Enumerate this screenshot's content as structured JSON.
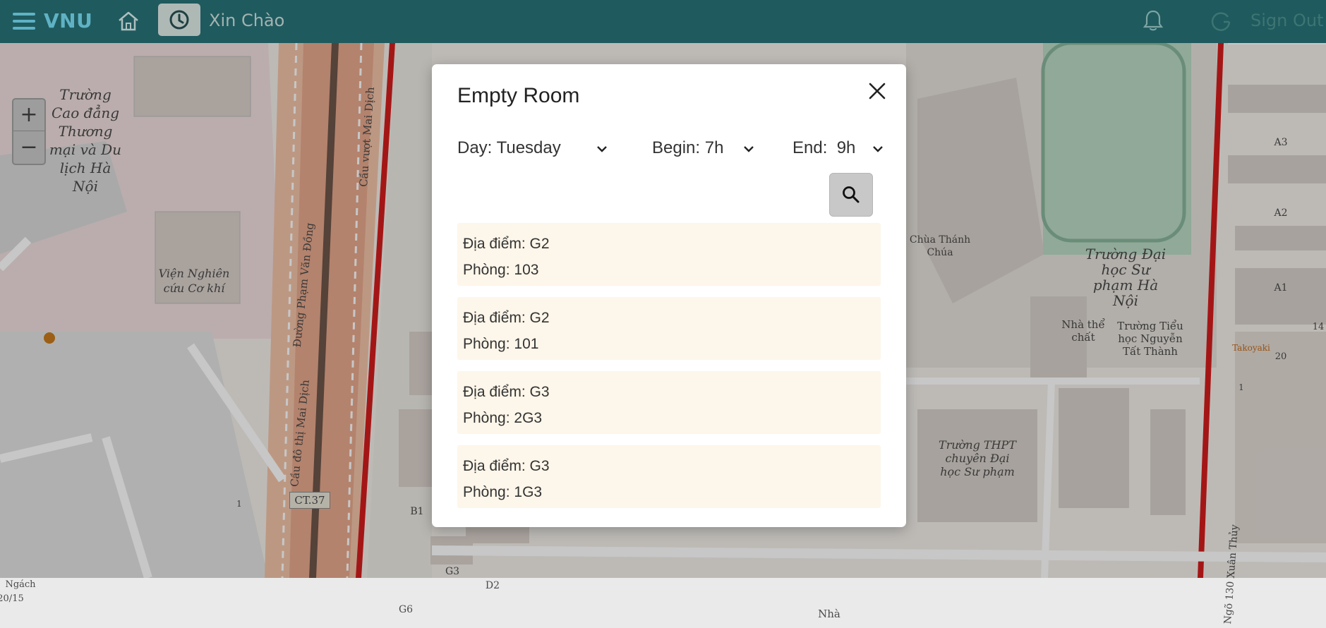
{
  "header": {
    "brand": "VNU",
    "greeting": "Xin Chào",
    "sign_out": "Sign Out",
    "icons": [
      "menu-icon",
      "home-icon",
      "clock-icon",
      "bell-icon",
      "spinner-icon"
    ]
  },
  "map": {
    "zoom_in": "+",
    "zoom_out": "−",
    "labels": {
      "truong_cao_dang": "Trường Cao đẳng Thương mại và Du lịch Hà Nội",
      "vien_nghien_cuu": "Viện Nghiên cứu Cơ khí",
      "chua_thanh_chua": "Chùa Thánh Chúa",
      "dh_su_pham": "Trường Đại học Sư phạm Hà Nội",
      "nha_the_chat": "Nhà thể chất",
      "truong_tieu_hoc": "Trường Tiểu học Nguyễn Tất Thành",
      "thpt_chuyen": "Trường THPT chuyên Đại học Sư phạm",
      "road_pvd": "Đường Phạm Văn Đồng",
      "cau_vuot": "Cầu vượt Mai Dịch",
      "cau_do_thi": "Cầu đô thị Mai Dịch",
      "ct37": "CT.37",
      "takoyaki": "Takoyaki",
      "ngo_130": "Ngõ 130 Xuân Thủy",
      "ngach": "Ngách",
      "ngach_no": "20/15",
      "nha": "Nhà",
      "a1": "A1",
      "a2": "A2",
      "a3": "A3",
      "b1": "B1",
      "d2": "D2",
      "g3": "G3",
      "g6": "G6",
      "n14": "14",
      "n20": "20",
      "n1": "1",
      "n1b": "1"
    }
  },
  "modal": {
    "title": "Empty Room",
    "day_label": "Day: Tuesday",
    "begin_label": "Begin: 7h",
    "end_label": "End:  9h",
    "rooms": [
      {
        "location": "Địa điểm: G2",
        "room": "Phòng: 103"
      },
      {
        "location": "Địa điểm: G2",
        "room": "Phòng: 101"
      },
      {
        "location": "Địa điểm: G3",
        "room": "Phòng: 2G3"
      },
      {
        "location": "Địa điểm: G3",
        "room": "Phòng: 1G3"
      }
    ]
  },
  "colors": {
    "topbar": "#1f5a5e",
    "brand": "#5fb2c4",
    "card_bg": "#fdf6ea",
    "search_btn": "#c8c8c8"
  }
}
